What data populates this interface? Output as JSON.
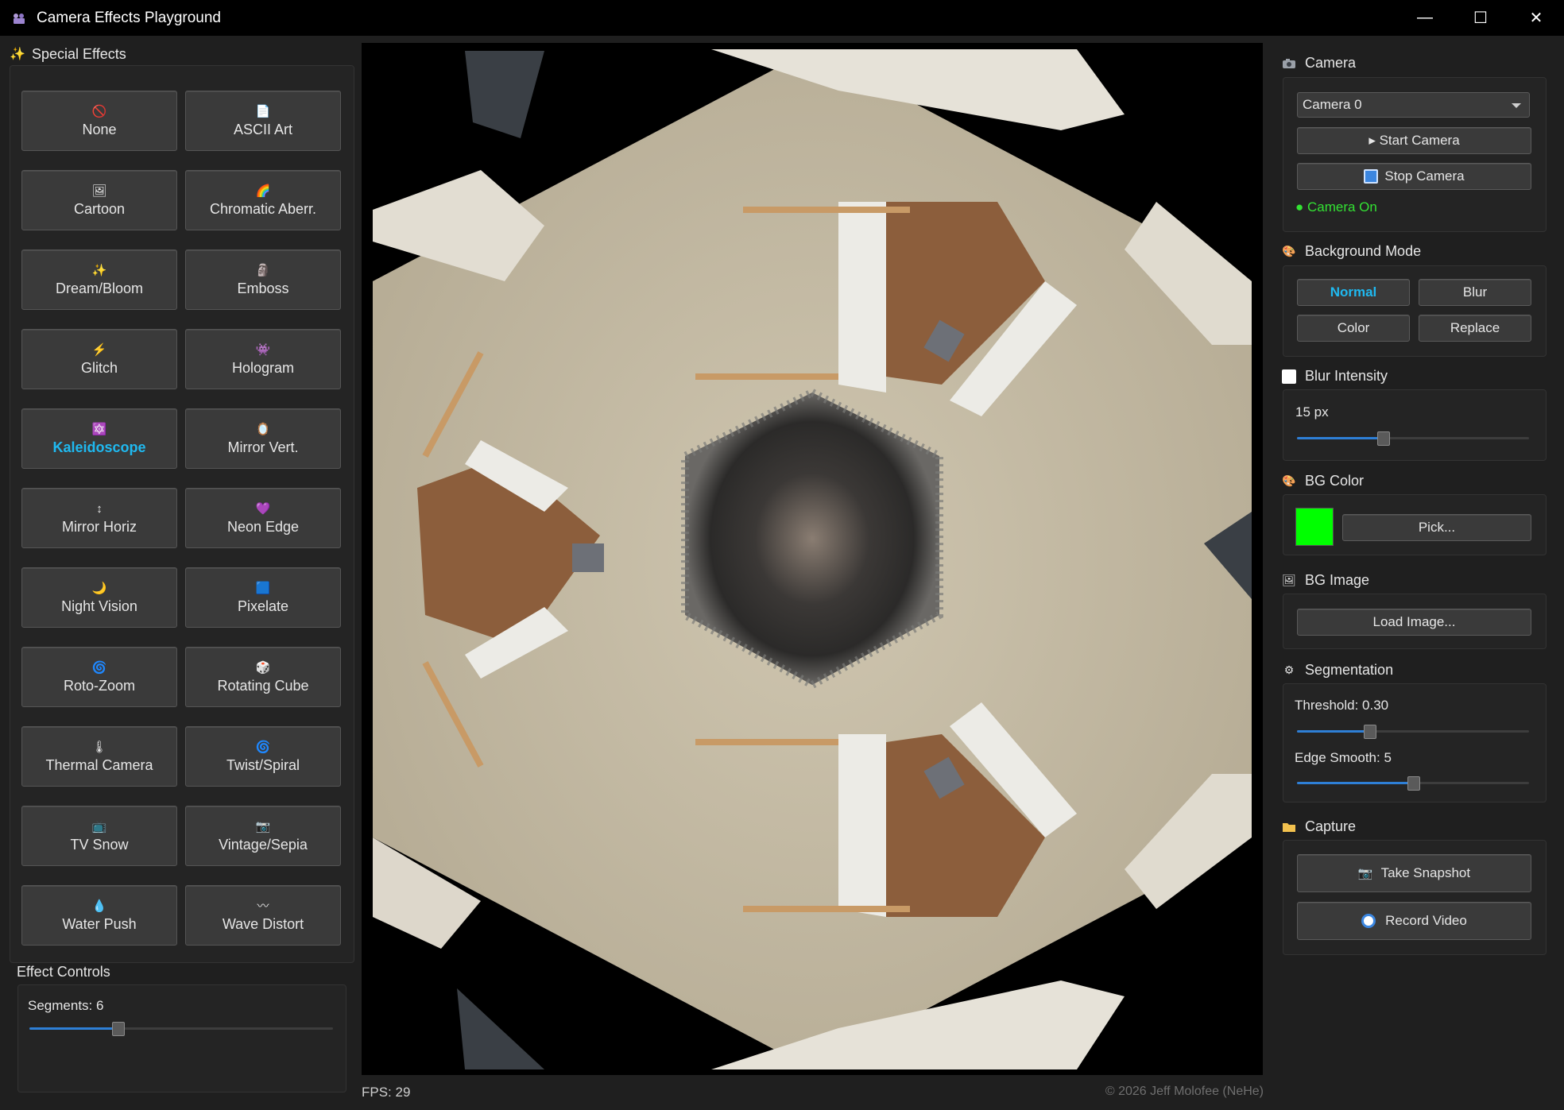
{
  "window": {
    "title": "Camera Effects Playground",
    "controls": [
      "—",
      "☐",
      "✕"
    ]
  },
  "left_panel": {
    "title": "Special Effects",
    "effects": [
      {
        "label": "None",
        "icon": "🚫",
        "active": false
      },
      {
        "label": "ASCII Art",
        "icon": "📄",
        "active": false
      },
      {
        "label": "Cartoon",
        "icon": "🖼",
        "active": false
      },
      {
        "label": "Chromatic Aberr.",
        "icon": "🌈",
        "active": false
      },
      {
        "label": "Dream/Bloom",
        "icon": "✨",
        "active": false
      },
      {
        "label": "Emboss",
        "icon": "🗿",
        "active": false
      },
      {
        "label": "Glitch",
        "icon": "⚡",
        "active": false
      },
      {
        "label": "Hologram",
        "icon": "👾",
        "active": false
      },
      {
        "label": "Kaleidoscope",
        "icon": "🔯",
        "active": true
      },
      {
        "label": "Mirror Vert.",
        "icon": "🪞",
        "active": false
      },
      {
        "label": "Mirror Horiz",
        "icon": "↕",
        "active": false
      },
      {
        "label": "Neon Edge",
        "icon": "💜",
        "active": false
      },
      {
        "label": "Night Vision",
        "icon": "🌙",
        "active": false
      },
      {
        "label": "Pixelate",
        "icon": "🟦",
        "active": false
      },
      {
        "label": "Roto-Zoom",
        "icon": "🌀",
        "active": false
      },
      {
        "label": "Rotating Cube",
        "icon": "🎲",
        "active": false
      },
      {
        "label": "Thermal Camera",
        "icon": "🌡",
        "active": false
      },
      {
        "label": "Twist/Spiral",
        "icon": "🌀",
        "active": false
      },
      {
        "label": "TV Snow",
        "icon": "📺",
        "active": false
      },
      {
        "label": "Vintage/Sepia",
        "icon": "📷",
        "active": false
      },
      {
        "label": "Water Push",
        "icon": "💧",
        "active": false
      },
      {
        "label": "Wave Distort",
        "icon": "〰",
        "active": false
      }
    ],
    "effect_controls": {
      "title": "Effect Controls",
      "segments_label": "Segments: 6",
      "segments_fraction": 0.29
    }
  },
  "viewport": {
    "fps": "FPS: 29",
    "copyright": "© 2026 Jeff Molofee (NeHe)"
  },
  "right_panel": {
    "camera": {
      "title": "Camera",
      "selected": "Camera 0",
      "start_label": "▸ Start Camera",
      "stop_label": "Stop Camera",
      "status": "● Camera On"
    },
    "background_mode": {
      "title": "Background Mode",
      "modes": [
        {
          "label": "Normal",
          "active": true
        },
        {
          "label": "Blur",
          "active": false
        },
        {
          "label": "Color",
          "active": false
        },
        {
          "label": "Replace",
          "active": false
        }
      ]
    },
    "blur_intensity": {
      "title": "Blur Intensity",
      "value_label": "15 px",
      "fraction": 0.37
    },
    "bg_color": {
      "title": "BG Color",
      "color": "#00ff00",
      "pick_label": "Pick..."
    },
    "bg_image": {
      "title": "BG Image",
      "load_label": "Load Image..."
    },
    "segmentation": {
      "title": "Segmentation",
      "threshold_label": "Threshold: 0.30",
      "threshold_fraction": 0.31,
      "edge_label": "Edge Smooth: 5",
      "edge_fraction": 0.5
    },
    "capture": {
      "title": "Capture",
      "snapshot_label": "Take Snapshot",
      "record_label": "Record Video"
    }
  },
  "colors": {
    "accent": "#1fb9f0",
    "status_green": "#33e233",
    "slider_fill": "#2e7fd6"
  }
}
